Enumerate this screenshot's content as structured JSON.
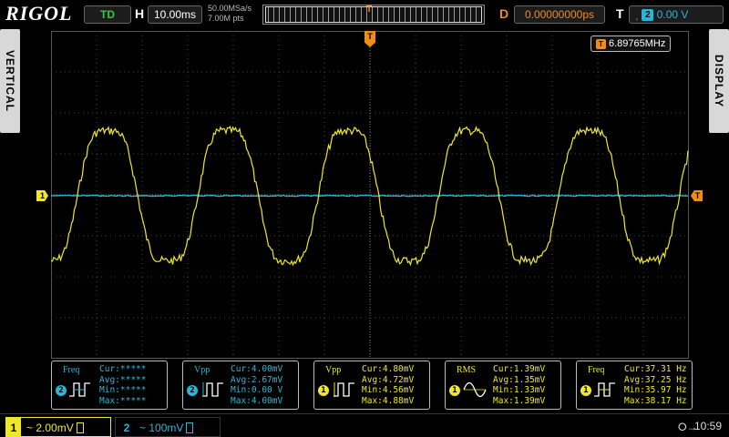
{
  "header": {
    "brand": "RIGOL",
    "run_state": "TD",
    "horizontal_label": "H",
    "timebase": "10.00ms",
    "sample_rate": "50.00MSa/s",
    "memory_depth": "7.00M pts",
    "trigger_position_marker": "T",
    "delay_label": "D",
    "delay_value": "0.00000000ps",
    "trigger_label": "T",
    "trigger_source": "2",
    "trigger_level": "0.00 V"
  },
  "side_tabs": {
    "left": "VERTICAL",
    "right": "DISPLAY"
  },
  "frequency_counter": {
    "icon": "T",
    "value": "6.89765MHz"
  },
  "markers": {
    "ch1": "1",
    "trigger_level": "T",
    "trigger_position": "T"
  },
  "colors": {
    "ch1": "#f0e72a",
    "ch2": "#29b6d6",
    "trigger": "#f08c1a"
  },
  "trace": {
    "ch1": {
      "periods_on_screen": 5.3,
      "amplitude_fraction": 0.45,
      "noise": true
    },
    "ch2": {
      "flat": true
    }
  },
  "measurements": [
    {
      "name": "Freq",
      "source": "2",
      "lines": [
        "Cur:*****",
        "Avg:*****",
        "Min:*****",
        "Max:*****"
      ]
    },
    {
      "name": "Vpp",
      "source": "2",
      "lines": [
        "Cur:4.00mV",
        "Avg:2.67mV",
        "Min:0.00 V",
        "Max:4.00mV"
      ]
    },
    {
      "name": "Vpp",
      "source": "1",
      "lines": [
        "Cur:4.80mV",
        "Avg:4.72mV",
        "Min:4.56mV",
        "Max:4.88mV"
      ]
    },
    {
      "name": "RMS",
      "source": "1",
      "lines": [
        "Cur:1.39mV",
        "Avg:1.35mV",
        "Min:1.33mV",
        "Max:1.39mV"
      ]
    },
    {
      "name": "Freq",
      "source": "1",
      "lines": [
        "Cur:37.31 Hz",
        "Avg:37.25 Hz",
        "Min:35.97 Hz",
        "Max:38.17 Hz"
      ]
    }
  ],
  "footer": {
    "ch1": {
      "num": "1",
      "scale": "~ 2.00mV"
    },
    "ch2": {
      "num": "2",
      "scale": "~ 100mV"
    },
    "usb_icon": "usb-icon",
    "time": "10:59"
  }
}
